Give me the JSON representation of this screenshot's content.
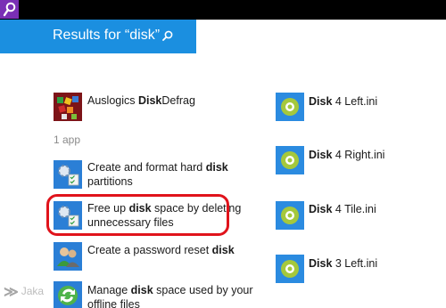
{
  "header": {
    "title": "Results for “disk”"
  },
  "apps": {
    "top": {
      "prefix": "Auslogics ",
      "bold": "Disk",
      "suffix": "Defrag"
    },
    "section_label": "1 app"
  },
  "settings": [
    {
      "line1_prefix": "Create and format hard ",
      "line1_bold": "disk",
      "line1_suffix": "",
      "line2": "partitions"
    },
    {
      "line1_prefix": "Free up ",
      "line1_bold": "disk",
      "line1_suffix": " space by deleting",
      "line2": "unnecessary files"
    },
    {
      "line1_prefix": "Create a password reset ",
      "line1_bold": "disk",
      "line1_suffix": "",
      "line2": ""
    },
    {
      "line1_prefix": "Manage ",
      "line1_bold": "disk",
      "line1_suffix": " space used by your",
      "line2": "offline files"
    }
  ],
  "files": [
    {
      "bold": "Disk",
      "rest": " 4 Left.ini"
    },
    {
      "bold": "Disk",
      "rest": " 4 Right.ini"
    },
    {
      "bold": "Disk",
      "rest": " 4 Tile.ini"
    },
    {
      "bold": "Disk",
      "rest": " 3 Left.ini"
    }
  ],
  "watermark": "Jaka",
  "colors": {
    "accent": "#1b8fe0",
    "charm": "#7a2fb5",
    "highlight": "#e0131b",
    "file_tile": "#2b8be0",
    "file_icon": "#a5c83c"
  },
  "icons": {
    "charm": "search-icon",
    "app": "defrag-app-icon",
    "settings": "control-panel-icon",
    "file": "settings-gear-icon"
  }
}
